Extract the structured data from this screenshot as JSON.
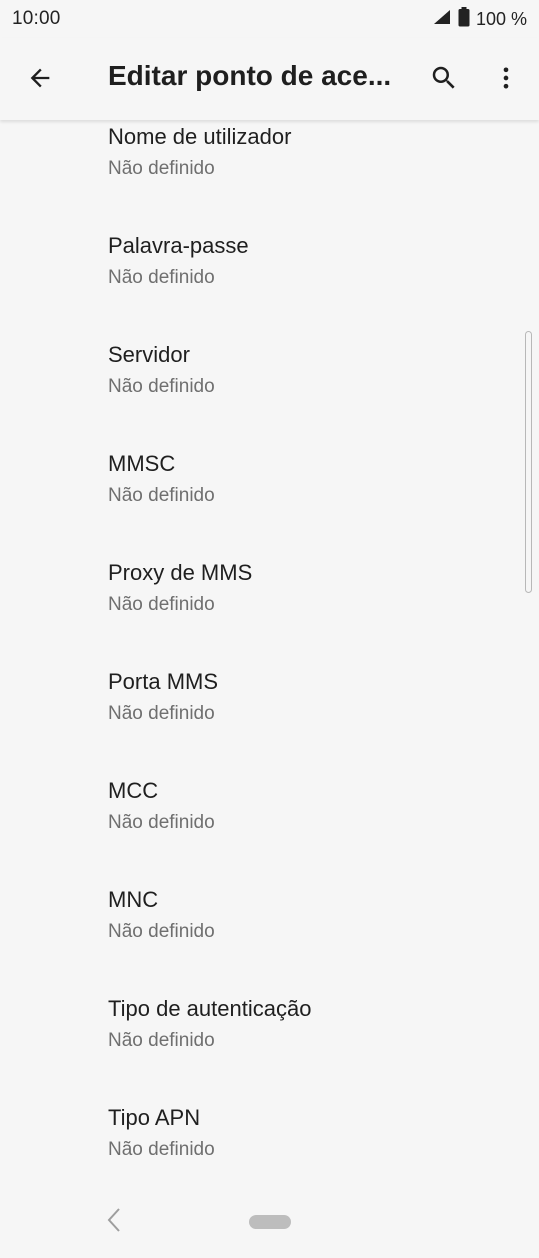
{
  "status_bar": {
    "time": "10:00",
    "battery_text": "100 %",
    "icons": [
      "signal-icon",
      "battery-icon"
    ]
  },
  "app_bar": {
    "title": "Editar ponto de ace...",
    "back_icon": "arrow-left-icon",
    "search_icon": "search-icon",
    "more_icon": "more-vert-icon"
  },
  "list": {
    "items": [
      {
        "title": "Nome de utilizador",
        "summary": "Não definido"
      },
      {
        "title": "Palavra-passe",
        "summary": "Não definido"
      },
      {
        "title": "Servidor",
        "summary": "Não definido"
      },
      {
        "title": "MMSC",
        "summary": "Não definido"
      },
      {
        "title": "Proxy de MMS",
        "summary": "Não definido"
      },
      {
        "title": "Porta MMS",
        "summary": "Não definido"
      },
      {
        "title": "MCC",
        "summary": "Não definido"
      },
      {
        "title": "MNC",
        "summary": "Não definido"
      },
      {
        "title": "Tipo de autenticação",
        "summary": "Não definido"
      },
      {
        "title": "Tipo APN",
        "summary": "Não definido"
      }
    ]
  },
  "nav_bar": {
    "back_icon": "chevron-left-icon",
    "home_icon": "home-pill-icon"
  },
  "colors": {
    "background": "#f6f6f6",
    "text_primary": "#1f1f1f",
    "text_secondary": "#6f6f6f"
  }
}
